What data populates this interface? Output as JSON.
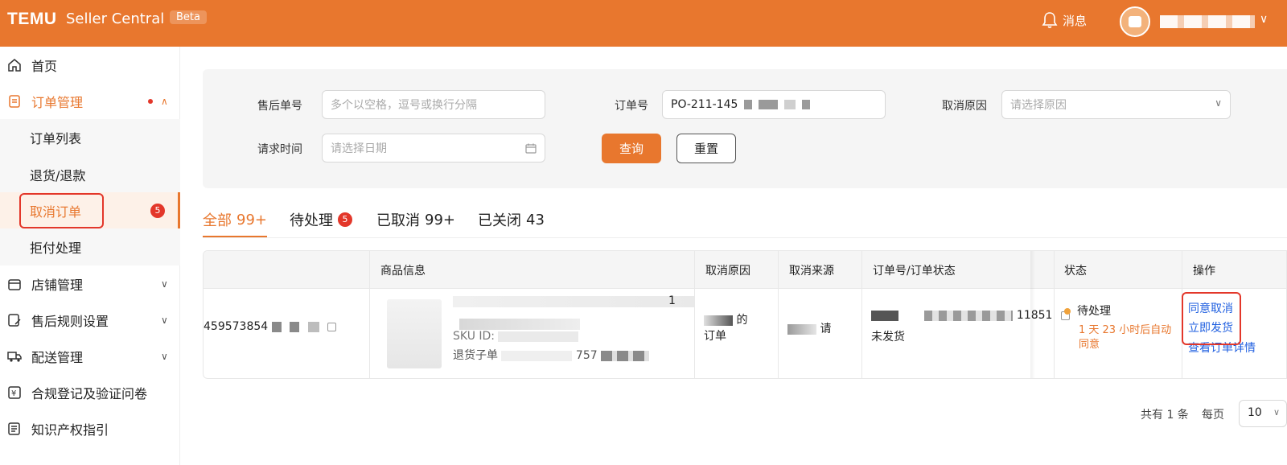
{
  "topbar": {
    "logo": "TEMU",
    "product": "Seller Central",
    "badge": "Beta",
    "messages_label": "消息",
    "brand_color": "#e8772e"
  },
  "sidebar": {
    "items": [
      {
        "label": "首页",
        "icon": "home-icon"
      },
      {
        "label": "订单管理",
        "icon": "order-icon"
      },
      {
        "label": "订单列表"
      },
      {
        "label": "退货/退款"
      },
      {
        "label": "取消订单",
        "badge": "5"
      },
      {
        "label": "拒付处理"
      },
      {
        "label": "店铺管理",
        "icon": "store-icon"
      },
      {
        "label": "售后规则设置",
        "icon": "rules-icon"
      },
      {
        "label": "配送管理",
        "icon": "truck-icon"
      },
      {
        "label": "合规登记及验证问卷",
        "icon": "compliance-icon"
      },
      {
        "label": "知识产权指引",
        "icon": "ip-icon"
      }
    ]
  },
  "filter": {
    "after_sale_no_label": "售后单号",
    "after_sale_no_placeholder": "多个以空格，逗号或换行分隔",
    "order_no_label": "订单号",
    "order_no_value": "PO-211-145",
    "cancel_reason_label": "取消原因",
    "cancel_reason_placeholder": "请选择原因",
    "request_time_label": "请求时间",
    "request_time_placeholder": "请选择日期",
    "query_button": "查询",
    "reset_button": "重置"
  },
  "tabs": [
    {
      "label": "全部",
      "count": "99+"
    },
    {
      "label": "待处理",
      "badge": "5"
    },
    {
      "label": "已取消",
      "count": "99+"
    },
    {
      "label": "已关闭",
      "count": "43"
    }
  ],
  "table": {
    "headers": [
      "商品信息",
      "取消原因",
      "取消来源",
      "订单号/订单状态",
      "状态",
      "操作"
    ],
    "row": {
      "id_visible": "459573854",
      "product_qty": "1",
      "product_sku": "SKU ID:",
      "product_sub": "退货子单",
      "product_sub_tail": "757",
      "reason_a": "的",
      "reason_b": "订单",
      "source_tail": "请",
      "order_no_tail": "11851",
      "order_status": "未发货",
      "status": "待处理",
      "status_note": "1 天 23 小时后自动同意",
      "actions": [
        "同意取消",
        "立即发货",
        "查看订单详情"
      ]
    }
  },
  "pagination": {
    "total": "共有 1 条",
    "per_page_label": "每页",
    "per_page": "10"
  }
}
